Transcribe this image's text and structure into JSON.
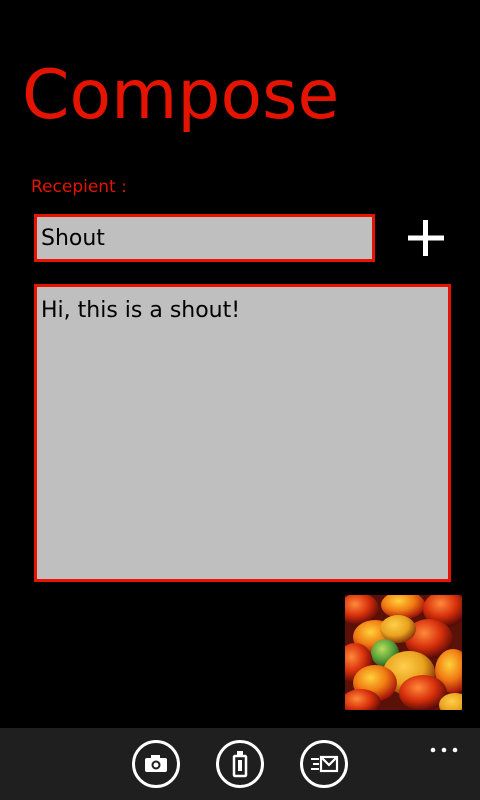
{
  "page": {
    "title": "Compose",
    "accent_color": "#e51400",
    "background_color": "#000000"
  },
  "recipient": {
    "label": "Recepient :",
    "value": "Shout",
    "add_icon": "plus-icon"
  },
  "message": {
    "value": "Hi, this is a shout!"
  },
  "attachment": {
    "icon": "photo-thumbnail"
  },
  "app_bar": {
    "buttons": [
      {
        "icon": "camera-icon"
      },
      {
        "icon": "shout-bottle-icon"
      },
      {
        "icon": "send-message-icon"
      }
    ],
    "more_icon": "ellipsis-icon"
  }
}
